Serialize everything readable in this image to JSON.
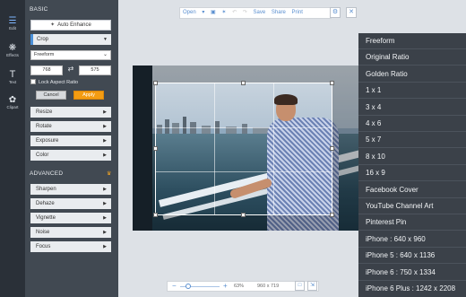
{
  "rail": [
    {
      "label": "Edit",
      "icon": "sliders-icon"
    },
    {
      "label": "Effects",
      "icon": "effects-icon"
    },
    {
      "label": "Text",
      "icon": "text-icon"
    },
    {
      "label": "Clipart",
      "icon": "clipart-icon"
    }
  ],
  "panel": {
    "basic_title": "BASIC",
    "auto_enhance": "Auto Enhance",
    "crop": "Crop",
    "aspect_select": "Freeform",
    "width_value": "768",
    "height_value": "575",
    "lock_label": "Lock Aspect Ratio",
    "cancel": "Cancel",
    "apply": "Apply",
    "basic_items": [
      "Resize",
      "Rotate",
      "Exposure",
      "Color"
    ],
    "advanced_title": "ADVANCED",
    "advanced_items": [
      "Sharpen",
      "Dehaze",
      "Vignette",
      "Noise",
      "Focus"
    ]
  },
  "toolbar": {
    "open": "Open",
    "save": "Save",
    "share": "Share",
    "print": "Print"
  },
  "zoom": {
    "percent": "63%",
    "dimensions": "960 x 719",
    "level": 0.63
  },
  "dropdown": [
    "Freeform",
    "Original Ratio",
    "Golden Ratio",
    "1 x 1",
    "3 x 4",
    "4 x 6",
    "5 x 7",
    "8 x 10",
    "16 x 9",
    "Facebook Cover",
    "YouTube Channel Art",
    "Pinterest Pin",
    "iPhone : 640 x 960",
    "iPhone 5 : 640 x 1136",
    "iPhone 6 : 750 x 1334",
    "iPhone 6 Plus : 1242 x 2208"
  ],
  "colors": {
    "accent": "#4a90d9",
    "apply": "#f39c12",
    "panel": "#414952",
    "dropdown": "#3b4149"
  }
}
